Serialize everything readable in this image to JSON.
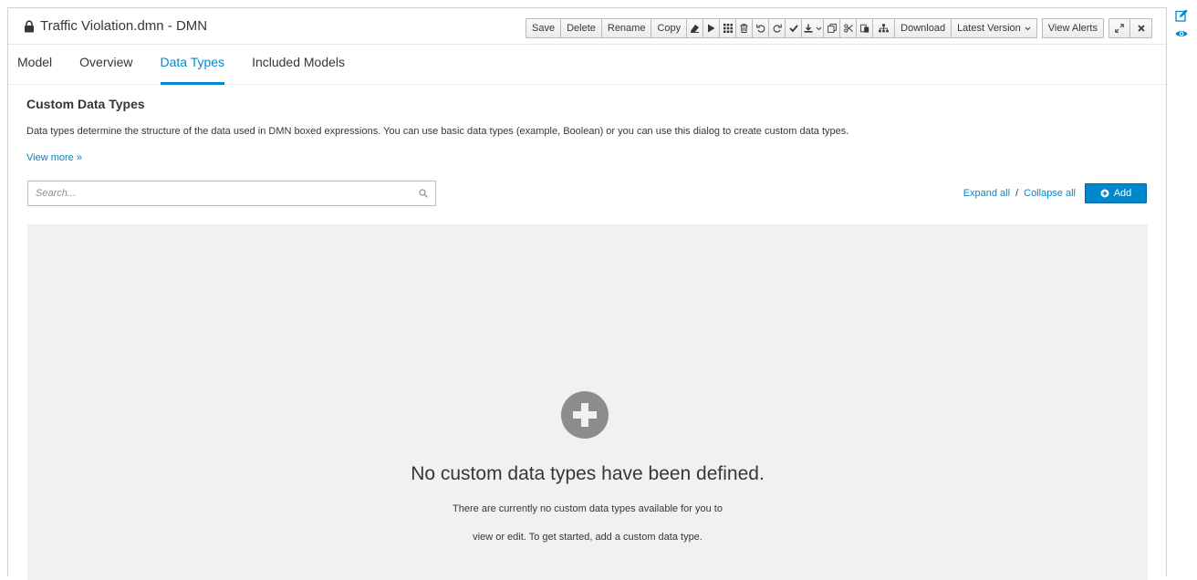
{
  "window": {
    "title": "Traffic Violation.dmn - DMN"
  },
  "toolbar": {
    "save_label": "Save",
    "delete_label": "Delete",
    "rename_label": "Rename",
    "copy_label": "Copy",
    "download_label": "Download",
    "latest_version_label": "Latest Version",
    "view_alerts_label": "View Alerts"
  },
  "tabs": [
    {
      "label": "Model",
      "active": false
    },
    {
      "label": "Overview",
      "active": false
    },
    {
      "label": "Data Types",
      "active": true
    },
    {
      "label": "Included Models",
      "active": false
    }
  ],
  "section": {
    "heading": "Custom Data Types",
    "description": "Data types determine the structure of the data used in DMN boxed expressions. You can use basic data types (example, Boolean) or you can use this dialog to create custom data types.",
    "view_more": "View more »"
  },
  "search": {
    "placeholder": "Search...",
    "value": ""
  },
  "actions": {
    "expand_all": "Expand all",
    "separator": "/",
    "collapse_all": "Collapse all",
    "add_label": "Add"
  },
  "empty_state": {
    "title": "No custom data types have been defined.",
    "line1": "There are currently no custom data types available for you to",
    "line2": "view or edit. To get started, add a custom data type."
  },
  "colors": {
    "accent": "#0088ce",
    "empty_bg": "#f1f1f1",
    "plus_icon": "#8b8d8f"
  },
  "icons": [
    "lock-icon",
    "eraser-icon",
    "play-icon",
    "grid-icon",
    "trash-icon",
    "undo-icon",
    "redo-icon",
    "check-icon",
    "download-icon",
    "duplicate-icon",
    "cut-icon",
    "paste-icon",
    "hierarchy-icon",
    "expand-icon",
    "close-icon",
    "search-icon",
    "plus-circle-icon",
    "edit-icon",
    "eye-icon"
  ]
}
